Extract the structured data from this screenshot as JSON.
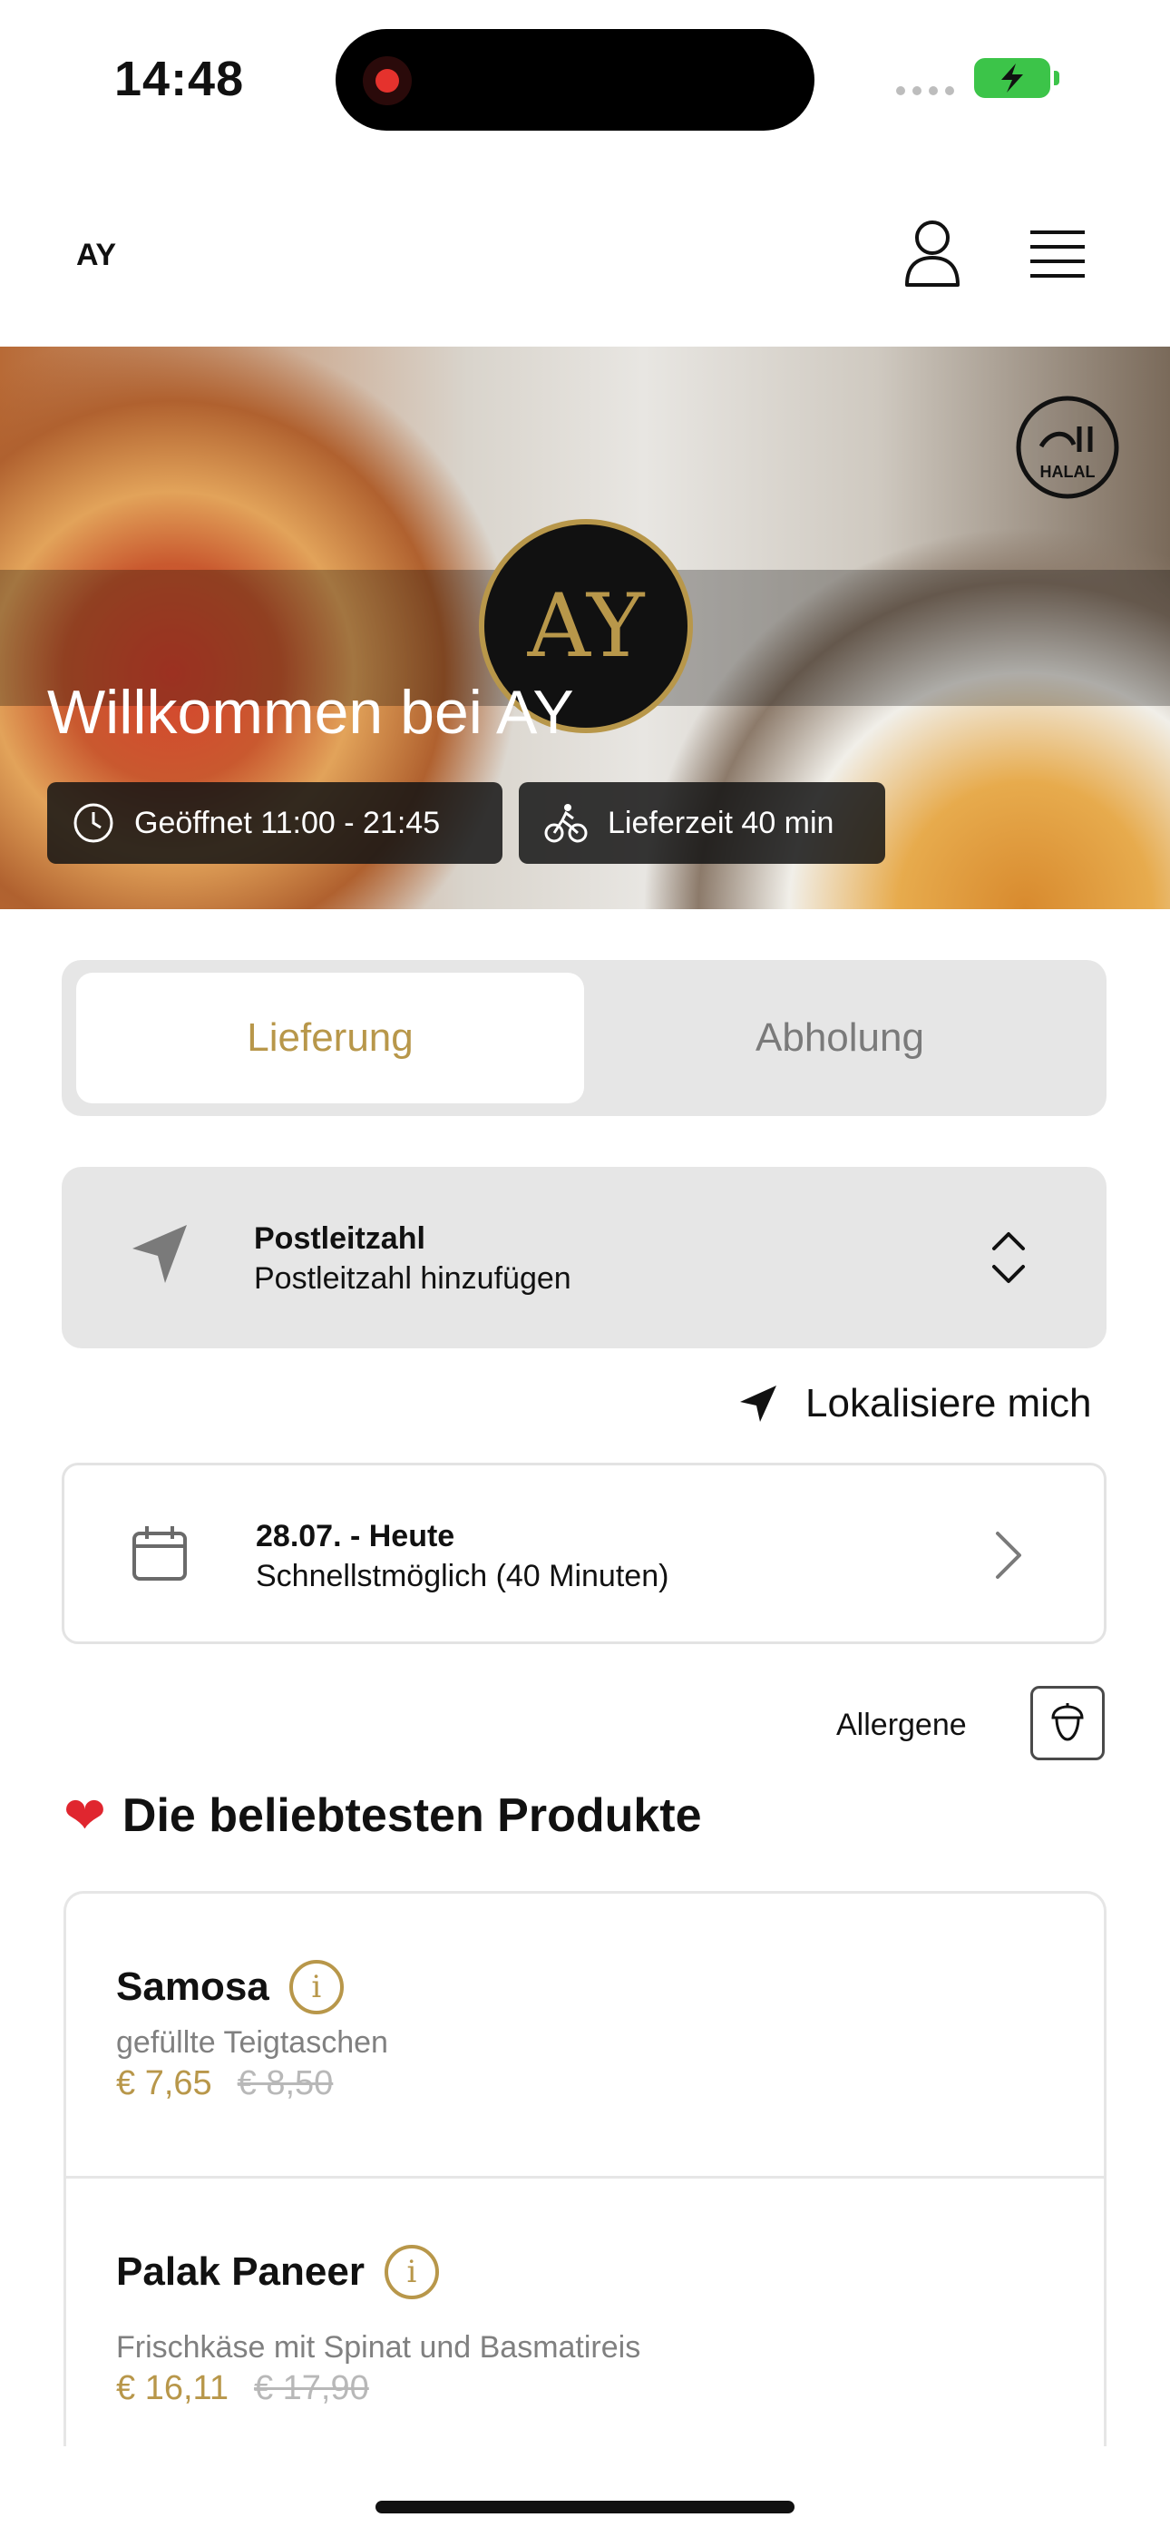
{
  "status_bar": {
    "time": "14:48"
  },
  "header": {
    "logo": "AY",
    "user_icon": "user-icon",
    "menu_icon": "hamburger-menu-icon"
  },
  "hero": {
    "title": "Willkommen bei AY",
    "halal_badge": "HALAL",
    "logo_text": "AY",
    "opening": "Geöffnet 11:00 - 21:45",
    "delivery_time": "Lieferzeit 40 min"
  },
  "mode_toggle": {
    "active": "Lieferung",
    "inactive": "Abholung"
  },
  "postal": {
    "title": "Postleitzahl",
    "placeholder": "Postleitzahl hinzufügen"
  },
  "locate": "Lokalisiere mich",
  "schedule": {
    "date": "28.07. - Heute",
    "time": "Schnellstmöglich (40 Minuten)"
  },
  "allergens": {
    "label": "Allergene"
  },
  "popular": {
    "heading": "Die beliebtesten Produkte",
    "items": [
      {
        "name": "Samosa",
        "description": "gefüllte Teigtaschen",
        "price": "€ 7,65",
        "old_price": "€ 8,50"
      },
      {
        "name": "Palak Paneer",
        "description": "Frischkäse mit Spinat und Basmatireis",
        "price": "€ 16,11",
        "old_price": "€ 17,90"
      }
    ]
  },
  "colors": {
    "accent": "#b8974a",
    "toggle_bg": "#e6e6e6",
    "text": "#111111"
  }
}
